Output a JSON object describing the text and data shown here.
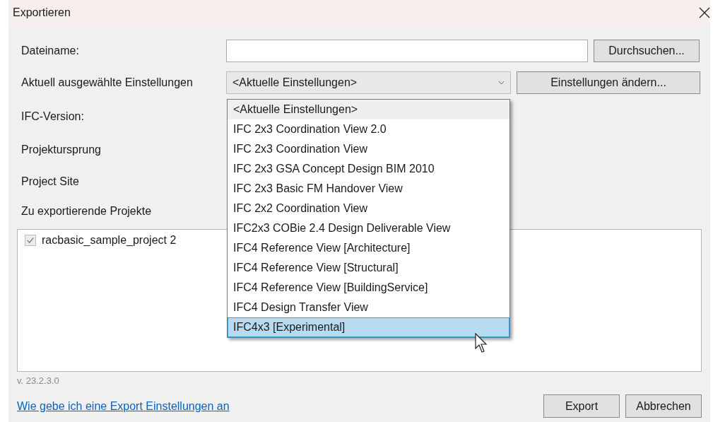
{
  "window": {
    "title": "Exportieren"
  },
  "filename": {
    "label": "Dateiname:",
    "browse_button": "Durchsuchen..."
  },
  "settings": {
    "label": "Aktuell ausgewählte Einstellungen",
    "value": "<Aktuelle Einstellungen>",
    "change_button": "Einstellungen ändern...",
    "expanded": true,
    "options": [
      {
        "label": "<Aktuelle Einstellungen>",
        "selected": true,
        "hovered": false
      },
      {
        "label": "IFC 2x3 Coordination View 2.0",
        "selected": false,
        "hovered": false
      },
      {
        "label": "IFC 2x3 Coordination View",
        "selected": false,
        "hovered": false
      },
      {
        "label": "IFC 2x3 GSA Concept Design BIM 2010",
        "selected": false,
        "hovered": false
      },
      {
        "label": "IFC 2x3 Basic FM Handover View",
        "selected": false,
        "hovered": false
      },
      {
        "label": "IFC 2x2 Coordination View",
        "selected": false,
        "hovered": false
      },
      {
        "label": "IFC2x3 COBie 2.4 Design Deliverable View",
        "selected": false,
        "hovered": false
      },
      {
        "label": "IFC4 Reference View [Architecture]",
        "selected": false,
        "hovered": false
      },
      {
        "label": "IFC4 Reference View [Structural]",
        "selected": false,
        "hovered": false
      },
      {
        "label": "IFC4 Reference View [BuildingService]",
        "selected": false,
        "hovered": false
      },
      {
        "label": "IFC4 Design Transfer View",
        "selected": false,
        "hovered": false
      },
      {
        "label": "IFC4x3 [Experimental]",
        "selected": false,
        "hovered": true
      }
    ]
  },
  "labels": [
    "IFC-Version:",
    "Projektursprung",
    "Project Site",
    "Zu exportierende Projekte"
  ],
  "projects": [
    {
      "label": "racbasic_sample_project 2",
      "checked": true,
      "disabled": true
    }
  ],
  "version": "v. 23.2.3.0",
  "help_link": "Wie gebe ich eine Export Einstellungen an",
  "buttons": [
    "Export",
    "Abbrechen"
  ]
}
